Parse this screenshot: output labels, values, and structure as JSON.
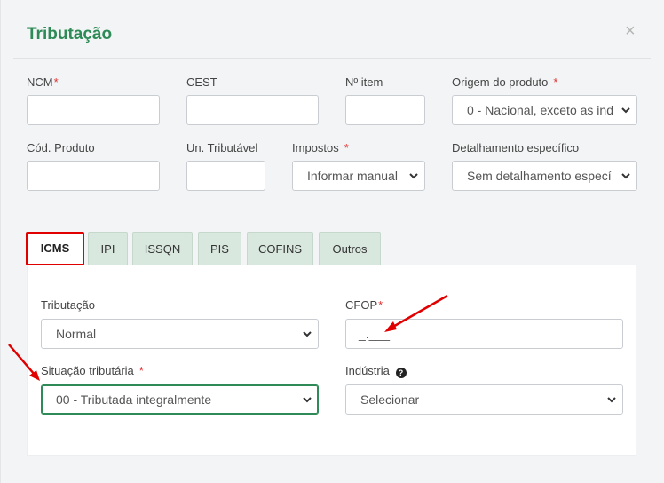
{
  "modal": {
    "title": "Tributação",
    "close_glyph": "×"
  },
  "fields": {
    "ncm": {
      "label": "NCM",
      "required": "*",
      "value": ""
    },
    "cest": {
      "label": "CEST",
      "value": ""
    },
    "n_item": {
      "label": "Nº item",
      "value": ""
    },
    "origem": {
      "label": "Origem do produto",
      "required": "*",
      "selected": "0 - Nacional, exceto as ind"
    },
    "cod_produto": {
      "label": "Cód. Produto",
      "value": ""
    },
    "un_tributavel": {
      "label": "Un. Tributável",
      "value": ""
    },
    "impostos": {
      "label": "Impostos",
      "required": "*",
      "selected": "Informar manual"
    },
    "detalhamento": {
      "label": "Detalhamento específico",
      "selected": "Sem detalhamento especí"
    }
  },
  "tabs": [
    {
      "label": "ICMS",
      "active": true
    },
    {
      "label": "IPI"
    },
    {
      "label": "ISSQN"
    },
    {
      "label": "PIS"
    },
    {
      "label": "COFINS"
    },
    {
      "label": "Outros"
    }
  ],
  "icms": {
    "tributacao": {
      "label": "Tributação",
      "selected": "Normal"
    },
    "cfop": {
      "label": "CFOP",
      "required": "*",
      "value": "_.___"
    },
    "situacao": {
      "label": "Situação tributária",
      "required": "*",
      "selected": "00 - Tributada integralmente"
    },
    "industria": {
      "label": "Indústria",
      "help_glyph": "?",
      "selected": "Selecionar"
    }
  },
  "colors": {
    "title_green": "#2e8b57",
    "tab_inactive_bg": "#d9e8df",
    "annotation_red": "#e00000"
  }
}
